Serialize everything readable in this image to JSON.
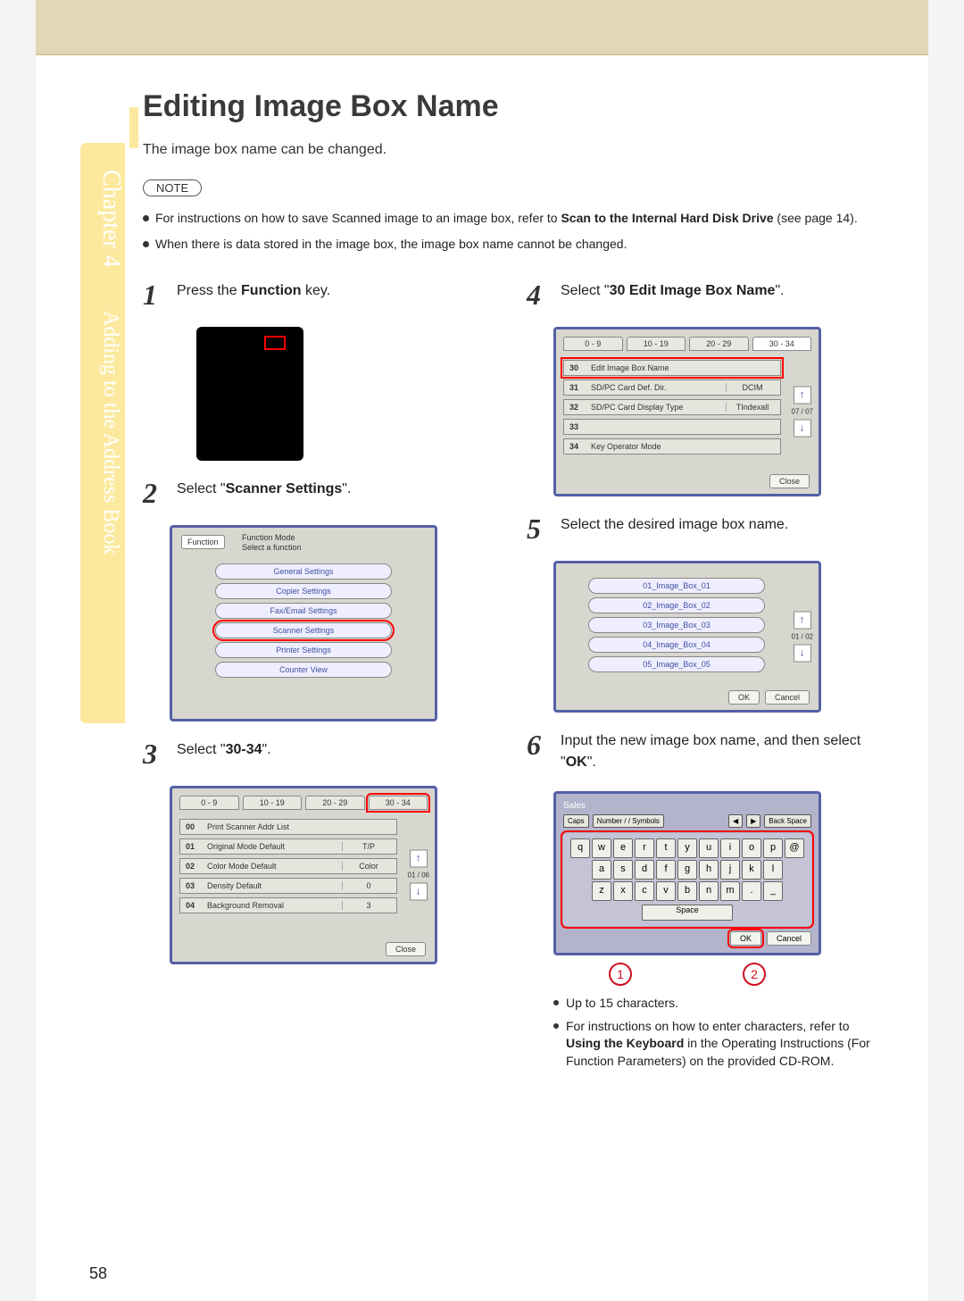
{
  "page_number": "58",
  "chapter": {
    "prefix": "Chapter",
    "number": "4",
    "title": "Adding to the Address Book"
  },
  "heading": "Editing Image Box Name",
  "intro": "The image box name can be changed.",
  "note_label": "NOTE",
  "notes": [
    {
      "pre": "For instructions on how to save Scanned image to an image box, refer to ",
      "bold": "Scan to the Internal Hard Disk Drive",
      "post": " (see page 14)."
    },
    {
      "pre": "When there is data stored in the image box, the image box name cannot be changed.",
      "bold": "",
      "post": ""
    }
  ],
  "steps": {
    "s1": {
      "num": "1",
      "a": "Press the ",
      "b": "Function",
      "c": " key."
    },
    "s2": {
      "num": "2",
      "a": "Select \"",
      "b": "Scanner Settings",
      "c": "\"."
    },
    "s3": {
      "num": "3",
      "a": "Select \"",
      "b": "30-34",
      "c": "\"."
    },
    "s4": {
      "num": "4",
      "a": "Select \"",
      "b": "30 Edit Image Box Name",
      "c": "\"."
    },
    "s5": {
      "num": "5",
      "text": "Select the desired image box name."
    },
    "s6": {
      "num": "6",
      "a": "Input the new image box name, and then select \"",
      "b": "OK",
      "c": "\"."
    }
  },
  "screen2": {
    "func_btn": "Function",
    "header1": "Function Mode",
    "header2": "Select a function",
    "items": [
      "General Settings",
      "Copier Settings",
      "Fax/Email Settings",
      "Scanner Settings",
      "Printer Settings",
      "Counter View"
    ]
  },
  "screen3": {
    "tabs": [
      "0 - 9",
      "10 - 19",
      "20 - 29",
      "30 - 34"
    ],
    "rows": [
      {
        "num": "00",
        "label": "Print Scanner Addr List",
        "val": ""
      },
      {
        "num": "01",
        "label": "Original Mode Default",
        "val": "T/P"
      },
      {
        "num": "02",
        "label": "Color Mode Default",
        "val": "Color"
      },
      {
        "num": "03",
        "label": "Density Default",
        "val": "0"
      },
      {
        "num": "04",
        "label": "Background Removal",
        "val": "3"
      }
    ],
    "scroll": "01 / 06",
    "close": "Close"
  },
  "screen4": {
    "tabs": [
      "0 - 9",
      "10 - 19",
      "20 - 29",
      "30 - 34"
    ],
    "rows": [
      {
        "num": "30",
        "label": "Edit Image Box Name",
        "val": ""
      },
      {
        "num": "31",
        "label": "SD/PC Card Def. Dir.",
        "val": "DCIM"
      },
      {
        "num": "32",
        "label": "SD/PC Card Display Type",
        "val": "TIndexall"
      },
      {
        "num": "33",
        "label": "",
        "val": ""
      },
      {
        "num": "34",
        "label": "Key Operator Mode",
        "val": ""
      }
    ],
    "scroll": "07 / 07",
    "close": "Close"
  },
  "screen5": {
    "items": [
      "01_Image_Box_01",
      "02_Image_Box_02",
      "03_Image_Box_03",
      "04_Image_Box_04",
      "05_Image_Box_05"
    ],
    "scroll": "01 / 02",
    "ok": "OK",
    "cancel": "Cancel"
  },
  "screen6": {
    "title": "Sales",
    "top_buttons": [
      "Caps",
      "Number / / Symbols",
      "◀",
      "▶",
      "Back Space"
    ],
    "row1": [
      "q",
      "w",
      "e",
      "r",
      "t",
      "y",
      "u",
      "i",
      "o",
      "p",
      "@"
    ],
    "row2": [
      "a",
      "s",
      "d",
      "f",
      "g",
      "h",
      "j",
      "k",
      "l"
    ],
    "row3": [
      "z",
      "x",
      "c",
      "v",
      "b",
      "n",
      "m",
      ".",
      "_"
    ],
    "space": "Space",
    "ok": "OK",
    "cancel": "Cancel"
  },
  "callouts": [
    "1",
    "2"
  ],
  "sub_notes": [
    {
      "text": "Up to 15 characters."
    },
    {
      "pre": "For instructions on how to enter characters, refer to ",
      "bold": "Using the Keyboard",
      "post": " in the Operating Instructions (For Function Parameters) on the provided CD-ROM."
    }
  ]
}
